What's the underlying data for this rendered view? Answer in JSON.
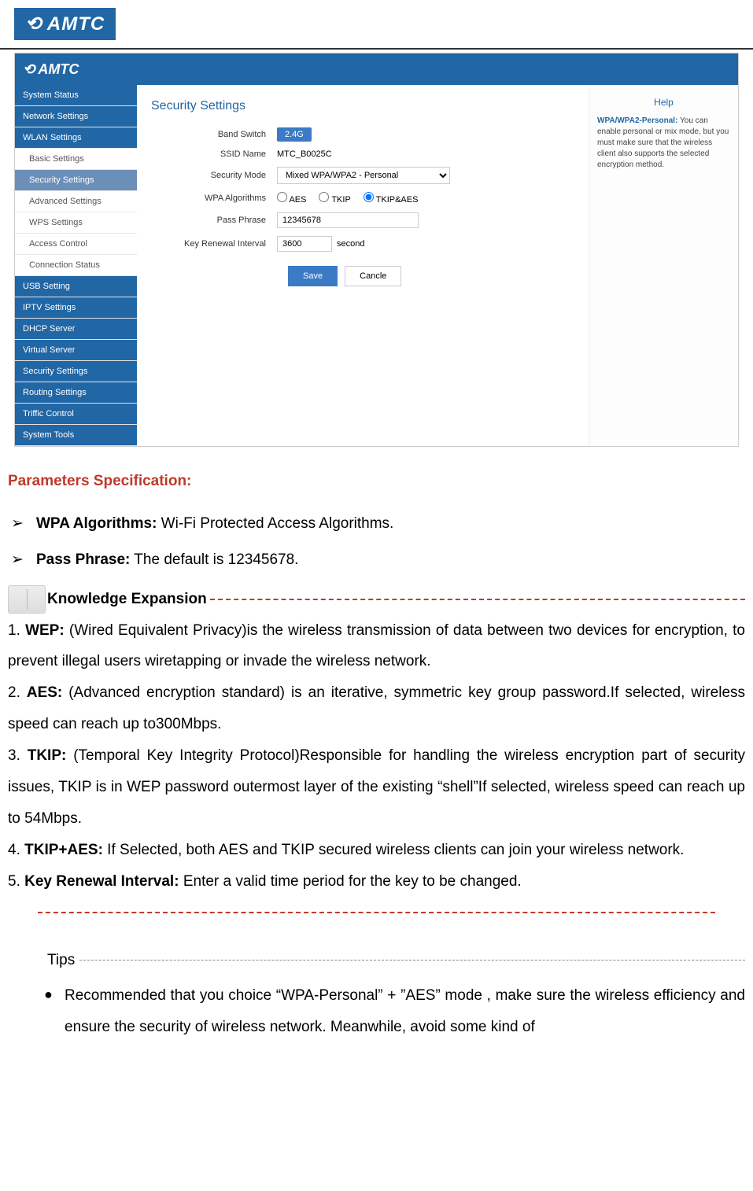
{
  "logo_text": "AMTC",
  "router": {
    "logo_text": "AMTC",
    "sidebar": [
      {
        "label": "System Status",
        "type": "header"
      },
      {
        "label": "Network Settings",
        "type": "header"
      },
      {
        "label": "WLAN Settings",
        "type": "header"
      },
      {
        "label": "Basic Settings",
        "type": "sub"
      },
      {
        "label": "Security Settings",
        "type": "sub_active"
      },
      {
        "label": "Advanced Settings",
        "type": "sub"
      },
      {
        "label": "WPS Settings",
        "type": "sub"
      },
      {
        "label": "Access Control",
        "type": "sub"
      },
      {
        "label": "Connection Status",
        "type": "sub"
      },
      {
        "label": "USB Setting",
        "type": "header"
      },
      {
        "label": "IPTV Settings",
        "type": "header"
      },
      {
        "label": "DHCP Server",
        "type": "header"
      },
      {
        "label": "Virtual Server",
        "type": "header"
      },
      {
        "label": "Security Settings",
        "type": "header"
      },
      {
        "label": "Routing Settings",
        "type": "header"
      },
      {
        "label": "Triffic Control",
        "type": "header"
      },
      {
        "label": "System Tools",
        "type": "header"
      }
    ],
    "panel": {
      "title": "Security Settings",
      "fields": {
        "band_switch": {
          "label": "Band Switch",
          "value": "2.4G"
        },
        "ssid_name": {
          "label": "SSID Name",
          "value": "MTC_B0025C"
        },
        "security_mode": {
          "label": "Security Mode",
          "value": "Mixed WPA/WPA2 - Personal"
        },
        "wpa_algorithms": {
          "label": "WPA Algorithms",
          "options": [
            "AES",
            "TKIP",
            "TKIP&AES"
          ],
          "selected": "TKIP&AES"
        },
        "pass_phrase": {
          "label": "Pass Phrase",
          "value": "12345678"
        },
        "key_renewal": {
          "label": "Key Renewal Interval",
          "value": "3600",
          "unit": "second"
        }
      },
      "buttons": {
        "save": "Save",
        "cancel": "Cancle"
      }
    },
    "help": {
      "title": "Help",
      "strong": "WPA/WPA2-Personal:",
      "text": " You can enable personal or mix mode, but you must make sure that the wireless client also supports the selected encryption method."
    }
  },
  "doc": {
    "params_title": "Parameters Specification:",
    "arrow": "➢",
    "bullets": [
      {
        "bold": "WPA Algorithms:",
        "rest": " Wi-Fi Protected Access Algorithms."
      },
      {
        "bold": "Pass Phrase:",
        "rest": " The default is 12345678."
      }
    ],
    "knowledge_title": "Knowledge Expansion",
    "knowledge": [
      {
        "n": "1. ",
        "bold": "WEP:",
        "rest": " (Wired Equivalent Privacy)is the wireless transmission of data between two devices for encryption, to prevent illegal users wiretapping or invade the wireless network."
      },
      {
        "n": "2. ",
        "bold": "AES:",
        "rest": " (Advanced encryption standard) is an iterative, symmetric key group password.If selected, wireless speed can reach up to300Mbps."
      },
      {
        "n": "3. ",
        "bold": "TKIP:",
        "rest": " (Temporal Key Integrity Protocol)Responsible for handling the wireless encryption part of security issues, TKIP is in WEP password outermost layer of the existing “shell”If selected, wireless speed can reach up to 54Mbps."
      },
      {
        "n": "4. ",
        "bold": "TKIP+AES:",
        "rest": " If Selected, both AES and TKIP secured wireless clients can join your wireless network."
      },
      {
        "n": "5. ",
        "bold": "Key Renewal Interval:",
        "rest": " Enter a valid time period for the key to be changed."
      }
    ],
    "tips_title": "Tips",
    "tips_dot": "●",
    "tips": [
      "Recommended that you choice “WPA-Personal” + ”AES” mode , make sure the wireless efficiency and ensure the security of wireless network. Meanwhile, avoid some kind of"
    ]
  }
}
